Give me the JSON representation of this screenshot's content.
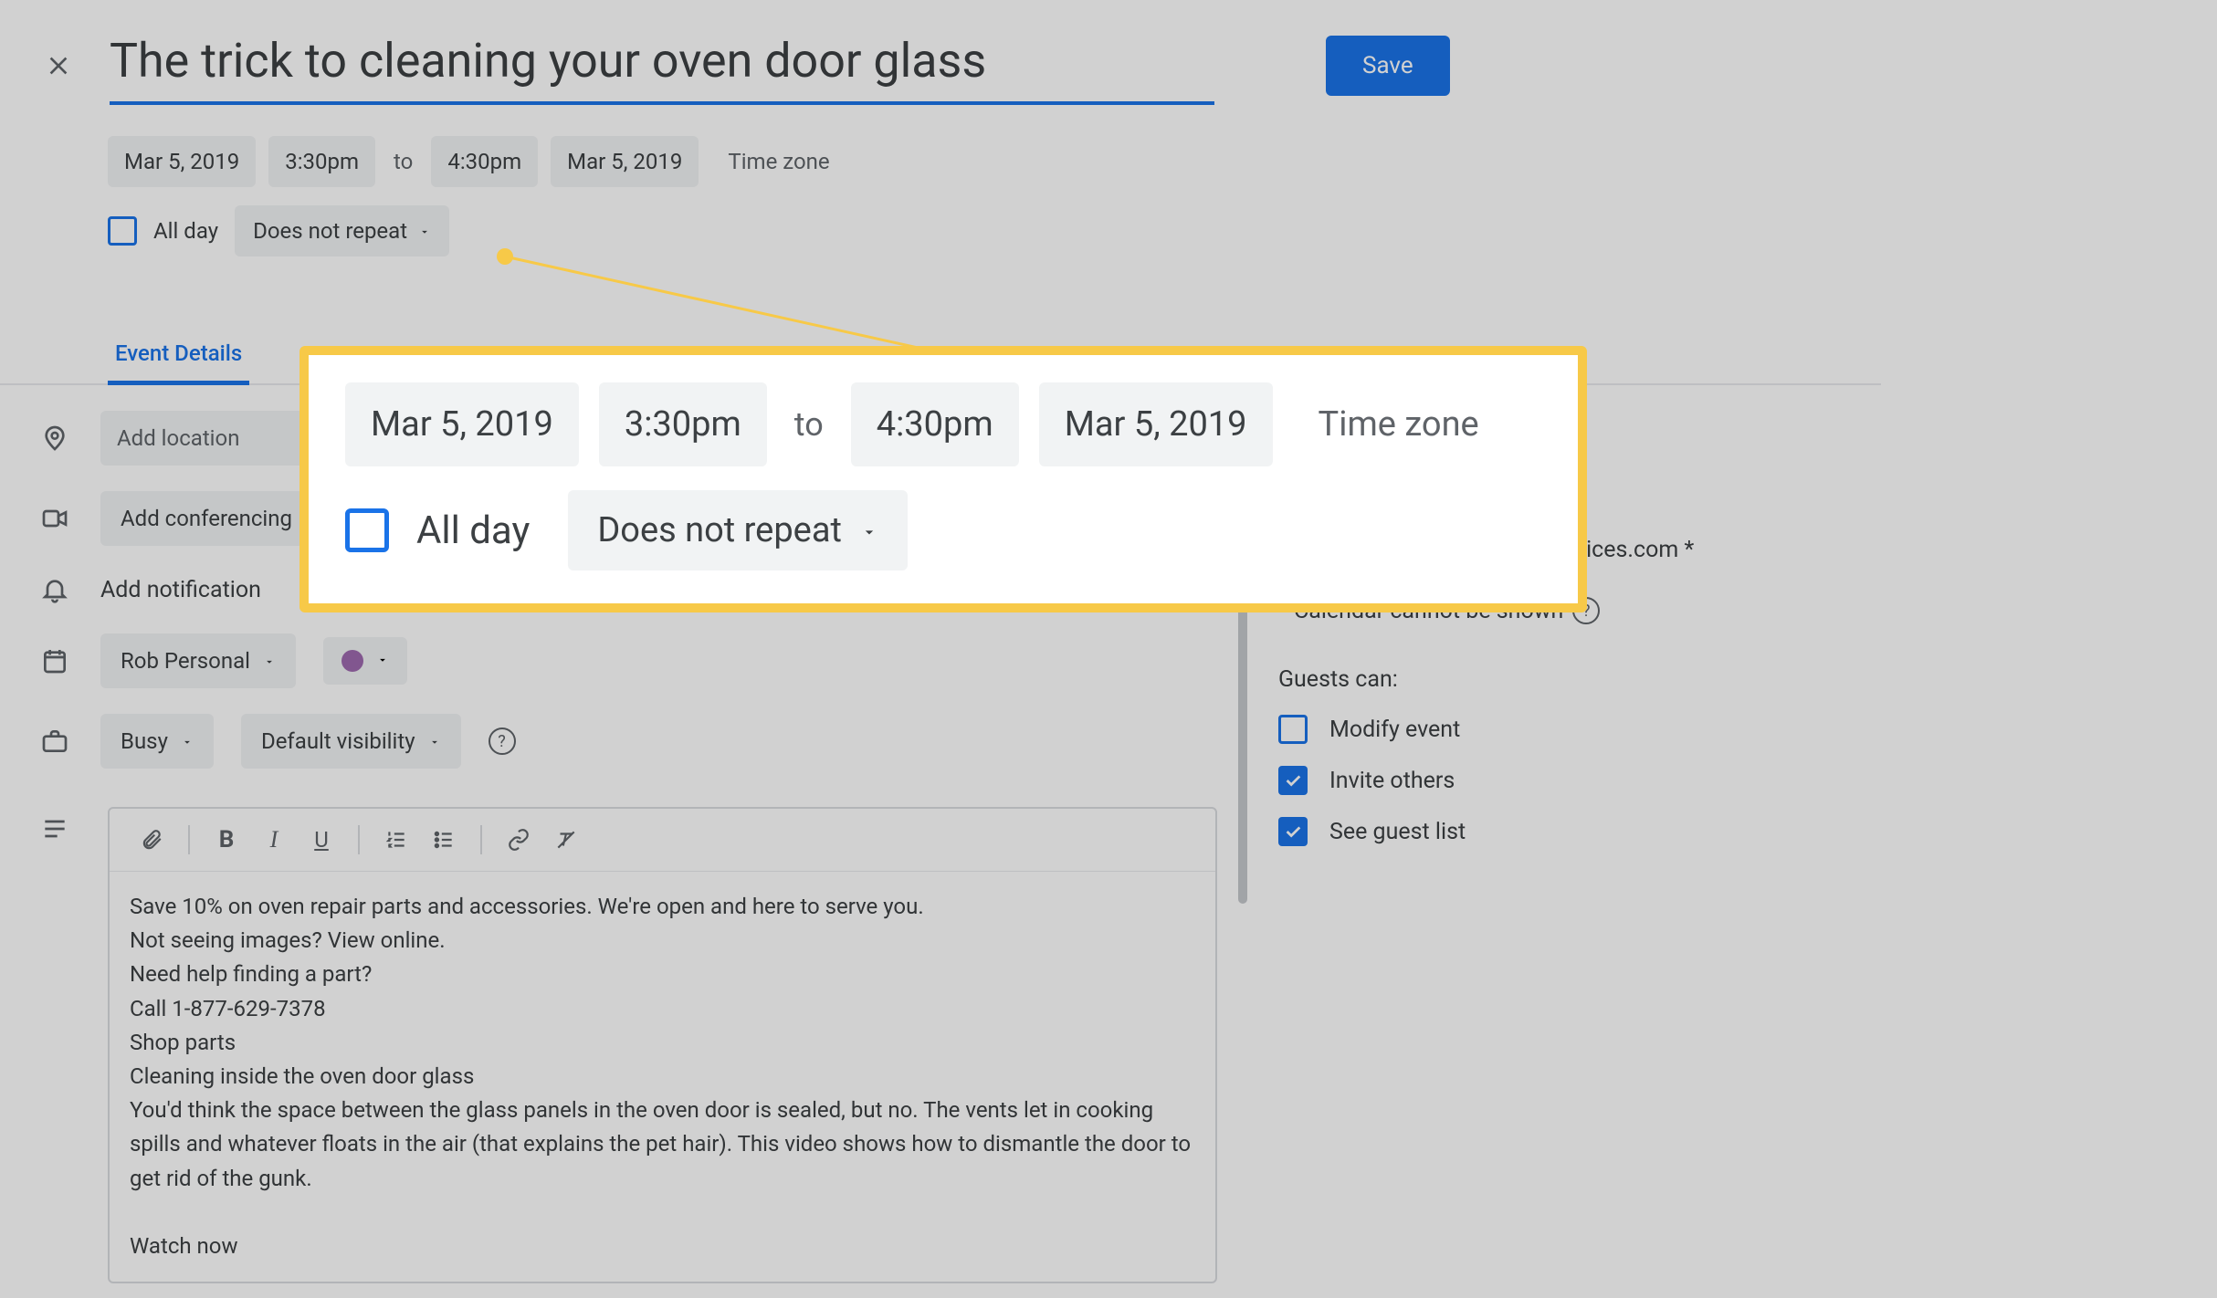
{
  "header": {
    "title": "The trick to cleaning your oven door glass",
    "save_label": "Save"
  },
  "dates": {
    "start_date": "Mar 5, 2019",
    "start_time": "3:30pm",
    "to_label": "to",
    "end_time": "4:30pm",
    "end_date": "Mar 5, 2019",
    "timezone_label": "Time zone",
    "all_day_label": "All day",
    "repeat_label": "Does not repeat"
  },
  "tabs": {
    "details": "Event Details"
  },
  "fields": {
    "location_placeholder": "Add location",
    "conferencing_placeholder": "Add conferencing",
    "notification_label": "Add notification",
    "calendar_name": "Rob Personal",
    "busy_label": "Busy",
    "visibility_label": "Default visibility"
  },
  "description": "Save 10% on oven repair parts and accessories. We're open and here to serve you.\nNot seeing images? View online.\nNeed help finding a part?\nCall 1-877-629-7378\nShop parts\nCleaning inside the oven door glass\nYou'd think the space between the glass panels in the oven door is sealed, but no. The vents let in cooking spills and whatever floats in the air (that explains the pet hair). This video shows how to dismantle the door to get rid of the gunk.\n\nWatch now",
  "guests": {
    "email": "shs@em.searshomeservices.com *",
    "hidden_label": "* Calendar cannot be shown",
    "can_label": "Guests can:",
    "modify_label": "Modify event",
    "invite_label": "Invite others",
    "see_label": "See guest list"
  },
  "callout": {
    "start_date": "Mar 5, 2019",
    "start_time": "3:30pm",
    "to_label": "to",
    "end_time": "4:30pm",
    "end_date": "Mar 5, 2019",
    "timezone_label": "Time zone",
    "all_day_label": "All day",
    "repeat_label": "Does not repeat"
  }
}
